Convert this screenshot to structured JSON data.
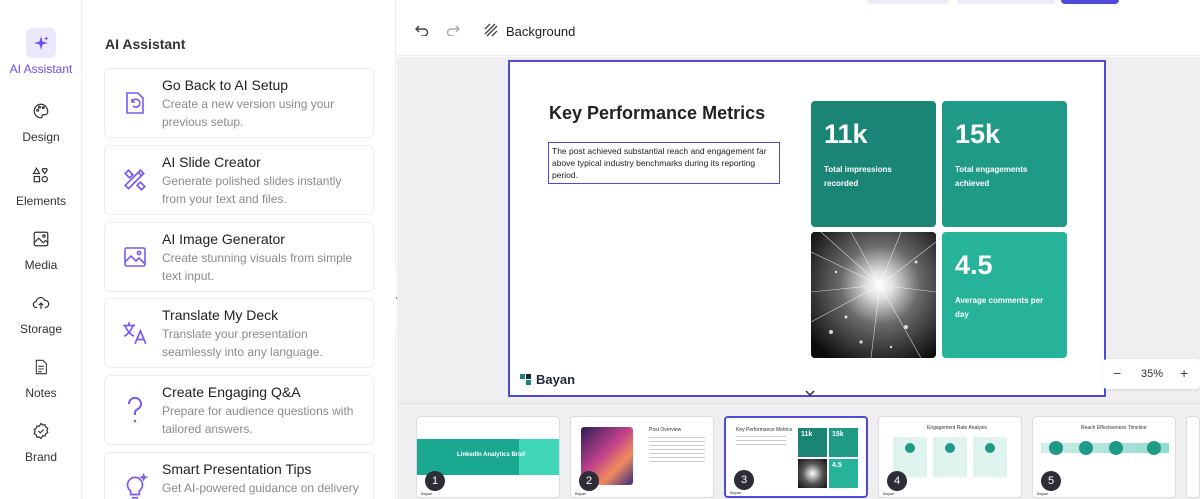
{
  "rail": {
    "items": [
      {
        "label": "AI Assistant",
        "icon": "sparkle-icon",
        "active": true
      },
      {
        "label": "Design",
        "icon": "palette-icon"
      },
      {
        "label": "Elements",
        "icon": "shapes-icon"
      },
      {
        "label": "Media",
        "icon": "image-icon"
      },
      {
        "label": "Storage",
        "icon": "cloud-upload-icon"
      },
      {
        "label": "Notes",
        "icon": "note-icon"
      },
      {
        "label": "Brand",
        "icon": "brand-badge-icon"
      }
    ]
  },
  "panel": {
    "title": "AI Assistant",
    "cards": [
      {
        "title": "Go Back to AI Setup",
        "desc": "Create a new version using your previous setup.",
        "icon": "restore-icon"
      },
      {
        "title": "AI Slide Creator",
        "desc": "Generate polished slides instantly from your text and files.",
        "icon": "pencil-ruler-icon"
      },
      {
        "title": "AI Image Generator",
        "desc": "Create stunning visuals from simple text input.",
        "icon": "image-icon"
      },
      {
        "title": "Translate My Deck",
        "desc": "Translate your presentation seamlessly into any language.",
        "icon": "translate-icon"
      },
      {
        "title": "Create Engaging Q&A",
        "desc": "Prepare for audience questions with tailored answers.",
        "icon": "question-icon"
      },
      {
        "title": "Smart Presentation Tips",
        "desc": "Get AI-powered guidance on delivery",
        "icon": "lightbulb-icon"
      }
    ]
  },
  "toolbar": {
    "background_label": "Background"
  },
  "slide": {
    "title": "Key Performance Metrics",
    "text": "The post achieved substantial reach and engagement far above typical industry benchmarks during its reporting period.",
    "tiles": [
      {
        "value": "11k",
        "label": "Total impressions recorded"
      },
      {
        "value": "15k",
        "label": "Total engagements achieved"
      },
      {
        "value": "4.5",
        "label": "Average comments per day"
      }
    ],
    "logo_text": "Bayan"
  },
  "zoom": {
    "minus": "−",
    "value": "35%",
    "plus": "+"
  },
  "thumbnails": [
    {
      "number": "1",
      "title": "LinkedIn Analytics Brief"
    },
    {
      "number": "2",
      "title": "Post Overview"
    },
    {
      "number": "3",
      "title": "Key Performance Metrics",
      "active": true
    },
    {
      "number": "4",
      "title": "Engagement Rate Analysis"
    },
    {
      "number": "5",
      "title": "Reach Effectiveness Timeline"
    }
  ],
  "colors": {
    "accent": "#6c4df0",
    "selection": "#4f4bd8",
    "teal_dark": "#1a8574",
    "teal": "#1f9a86",
    "teal_light": "#26b39a"
  }
}
